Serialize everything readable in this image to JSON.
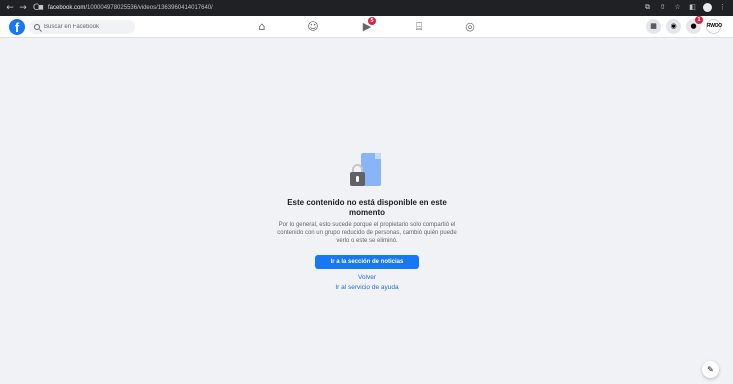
{
  "browser": {
    "url_domain": "facebook.com",
    "url_path": "/100004978025536/videos/1363960414017640/",
    "icons": [
      "back-arrow",
      "forward-arrow",
      "reload",
      "lock",
      "share",
      "star",
      "extensions",
      "profile",
      "menu"
    ]
  },
  "fb": {
    "logo_letter": "f",
    "search_placeholder": "Buscar en Facebook",
    "nav": [
      {
        "icon": "home-icon",
        "badge": ""
      },
      {
        "icon": "friends-icon",
        "badge": ""
      },
      {
        "icon": "video-icon",
        "badge": "5"
      },
      {
        "icon": "marketplace-icon",
        "badge": ""
      },
      {
        "icon": "gaming-icon",
        "badge": ""
      }
    ],
    "notification_badge": "1",
    "avatar_text": "RWOO"
  },
  "content": {
    "title": "Este contenido no está disponible en este momento",
    "description": "Por lo general, esto sucede porque el propietario solo compartió el contenido con un grupo reducido de personas, cambió quién puede verlo o este se eliminó.",
    "primary_button": "Ir a la sección de noticias",
    "back_link": "Volver",
    "help_link": "Ir al servicio de ayuda"
  },
  "colors": {
    "brand": "#1877f2",
    "badge": "#e41e3f",
    "page_bg": "#f0f2f5"
  }
}
